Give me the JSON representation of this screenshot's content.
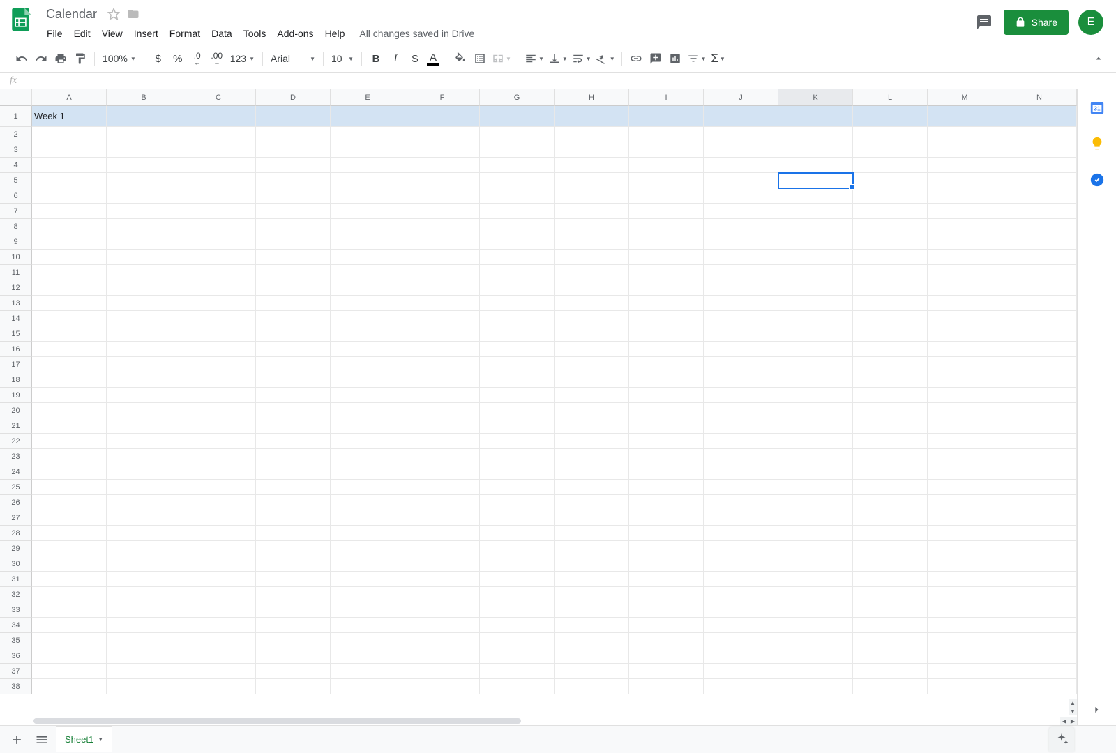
{
  "doc": {
    "title": "Calendar"
  },
  "menu": {
    "items": [
      "File",
      "Edit",
      "View",
      "Insert",
      "Format",
      "Data",
      "Tools",
      "Add-ons",
      "Help"
    ],
    "save_status": "All changes saved in Drive"
  },
  "header": {
    "share_label": "Share",
    "avatar_initial": "E"
  },
  "toolbar": {
    "zoom": "100%",
    "currency": "$",
    "percent": "%",
    "dec_dec": ".0",
    "inc_dec": ".00",
    "numfmt": "123",
    "font": "Arial",
    "font_size": "10"
  },
  "formula": {
    "fx": "fx",
    "value": ""
  },
  "grid": {
    "columns": [
      "A",
      "B",
      "C",
      "D",
      "E",
      "F",
      "G",
      "H",
      "I",
      "J",
      "K",
      "L",
      "M",
      "N"
    ],
    "row_count": 38,
    "tall_row": 1,
    "highlight_row": 1,
    "active_cell": {
      "row": 5,
      "col": "K"
    },
    "active_col_header": "K",
    "cells": {
      "A1": "Week 1"
    }
  },
  "sheets": {
    "add_tooltip": "Add Sheet",
    "all_tooltip": "All Sheets",
    "active": "Sheet1"
  },
  "side": {
    "calendar_day": "31"
  }
}
